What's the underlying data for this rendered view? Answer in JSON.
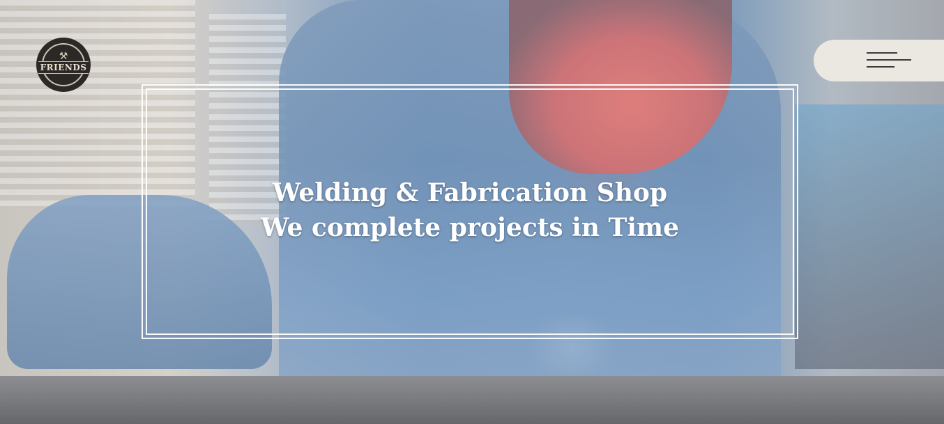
{
  "logo": {
    "text": "FRIENDS",
    "tools_glyph": "⚒"
  },
  "menu": {
    "icon": "hamburger-menu-icon"
  },
  "hero": {
    "title_line1": "Welding & Fabrication Shop",
    "title_line2": "We complete projects in Time",
    "background": "welding-workshop-photo"
  },
  "colors": {
    "menu_bg": "#ebe7e1",
    "frame": "#ffffff",
    "logo_bg": "#2b2826",
    "helmet": "#d9524c",
    "workwear": "#4a74a3"
  }
}
